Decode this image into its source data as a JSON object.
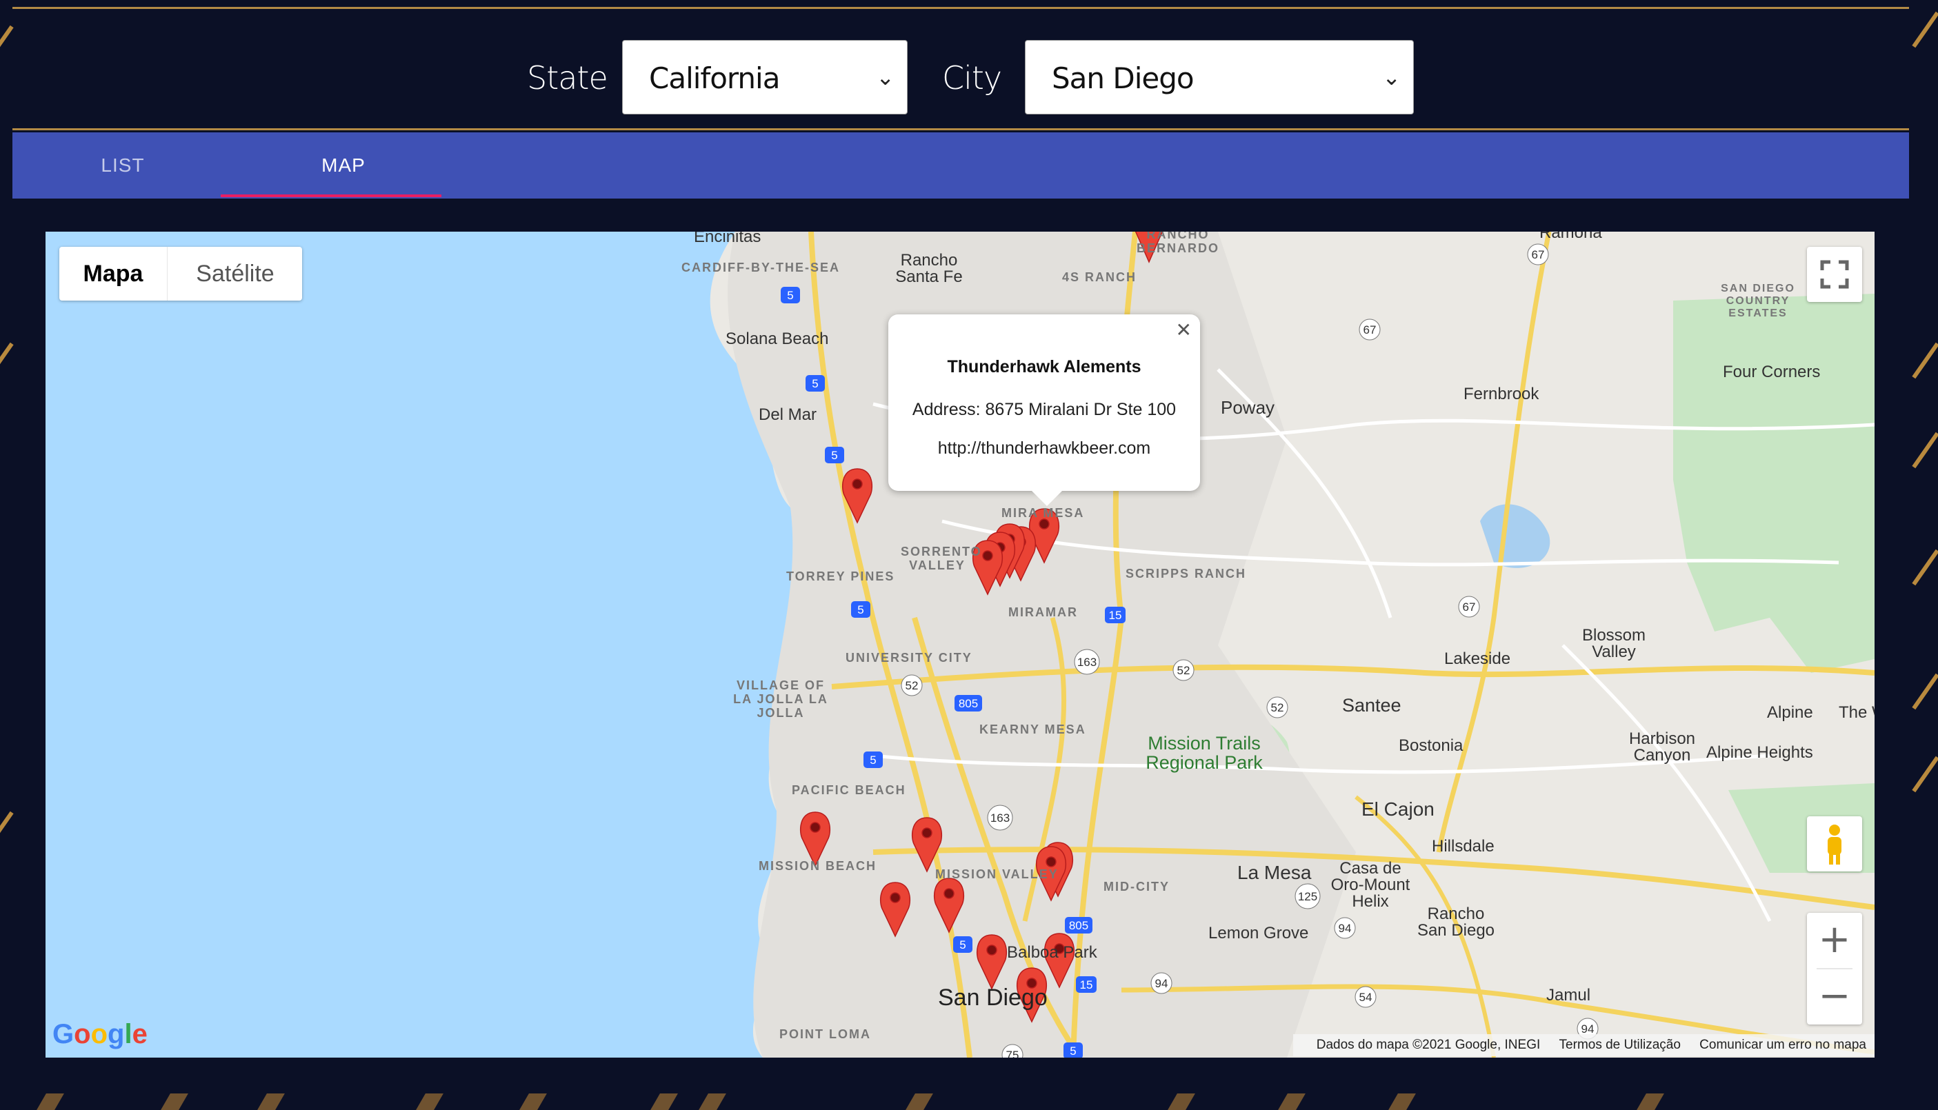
{
  "filters": {
    "state_label": "State",
    "state_value": "California",
    "city_label": "City",
    "city_value": "San Diego"
  },
  "tabs": [
    {
      "label": "LIST",
      "active": false
    },
    {
      "label": "MAP",
      "active": true
    }
  ],
  "map": {
    "map_type": {
      "map": "Mapa",
      "satellite": "Satélite"
    },
    "info_window": {
      "title": "Thunderhawk Alements",
      "address": "Address: 8675 Miralani Dr Ste 100",
      "url": "http://thunderhawkbeer.com"
    },
    "google_logo": "Google",
    "attribution": {
      "data": "Dados do mapa ©2021 Google, INEGI",
      "terms": "Termos de Utilização",
      "report": "Comunicar um erro no mapa"
    },
    "labels": {
      "encinitas": "Encinitas",
      "cardiff": "CARDIFF-BY-THE-SEA",
      "rancho_santa_fe": "Rancho Santa Fe",
      "fourS_ranch": "4S RANCH",
      "rancho_bernardo": "RANCHO BERNARDO",
      "ramona": "Ramona",
      "sd_country_estates": "SAN DIEGO COUNTRY ESTATES",
      "solana_beach": "Solana Beach",
      "del_mar": "Del Mar",
      "poway": "Poway",
      "fernbrook": "Fernbrook",
      "four_corners": "Four Corners",
      "sorrento_valley": "SORRENTO VALLEY",
      "mira_mesa": "MIRA MESA",
      "torrey_pines": "TORREY PINES",
      "scripps_ranch": "SCRIPPS RANCH",
      "miramar": "MIRAMAR",
      "university_city": "UNIVERSITY CITY",
      "la_jolla": "VILLAGE OF LA JOLLA LA JOLLA",
      "blossom_valley": "Blossom Valley",
      "lakeside": "Lakeside",
      "santee": "Santee",
      "alpine": "Alpine",
      "the_w": "The W",
      "bostonia": "Bostonia",
      "kearny_mesa": "KEARNY MESA",
      "mission_trails": "Mission Trails Regional Park",
      "harbison_canyon": "Harbison Canyon",
      "alpine_heights": "Alpine Heights",
      "pacific_beach": "PACIFIC BEACH",
      "el_cajon": "El Cajon",
      "hillsdale": "Hillsdale",
      "mission_beach": "MISSION BEACH",
      "mission_valley": "MISSION VALLEY",
      "mid_city": "MID-CITY",
      "la_mesa": "La Mesa",
      "casa_de_oro": "Casa de Oro-Mount Helix",
      "lemon_grove": "Lemon Grove",
      "rancho_san_diego": "Rancho San Diego",
      "san_diego": "San Diego",
      "balboa_park": "Balboa Park",
      "jamul": "Jamul",
      "point_loma": "POINT LOMA"
    },
    "route_shields": [
      "5",
      "5",
      "5",
      "5",
      "5",
      "5",
      "67",
      "67",
      "67",
      "15",
      "163",
      "52",
      "52",
      "52",
      "805",
      "163",
      "125",
      "94",
      "805",
      "15",
      "94",
      "54",
      "94",
      "75",
      "5"
    ]
  },
  "colors": {
    "background": "#0b1026",
    "tab_bar": "#3f51b5",
    "tab_indicator": "#e91e63",
    "gold": "#b38b45",
    "water": "#aadaff",
    "marker": "#ea4335"
  }
}
